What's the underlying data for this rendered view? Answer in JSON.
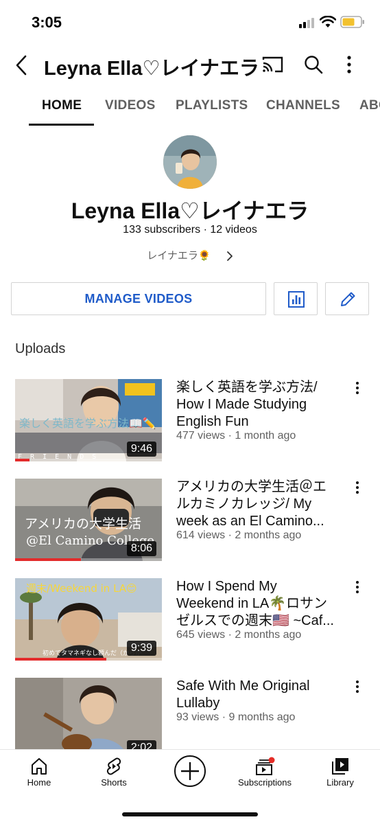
{
  "status_bar": {
    "time": "3:05"
  },
  "header": {
    "title": "Leyna Ella♡レイナエラ"
  },
  "tabs": [
    {
      "label": "HOME",
      "active": true
    },
    {
      "label": "VIDEOS",
      "active": false
    },
    {
      "label": "PLAYLISTS",
      "active": false
    },
    {
      "label": "CHANNELS",
      "active": false
    },
    {
      "label": "ABOUT",
      "active": false
    }
  ],
  "channel": {
    "name": "Leyna Ella♡レイナエラ",
    "meta": "133 subscribers · 12 videos",
    "description": "レイナエラ🌻"
  },
  "actions": {
    "manage_label": "MANAGE VIDEOS"
  },
  "uploads": {
    "label": "Uploads",
    "videos": [
      {
        "title_lines": [
          "楽しく英語を学ぶ方法/",
          "How I Made Studying",
          "English Fun"
        ],
        "meta": "477 views · 1 month ago",
        "duration": "9:46",
        "watched": 0.1,
        "thumb_text": "楽しく英語を学ぶ方法📖✏️"
      },
      {
        "title_lines": [
          "アメリカの大学生活＠エ",
          "ルカミノカレッジ/ My",
          "week as an El Camino..."
        ],
        "meta": "614 views · 2 months ago",
        "duration": "8:06",
        "watched": 0.45,
        "thumb_text": "アメリカの大学生活"
      },
      {
        "title_lines": [
          "How I Spend My",
          "Weekend in LA🌴ロサン",
          "ゼルスでの週末🇺🇸 ~Caf..."
        ],
        "meta": "645 views · 2 months ago",
        "duration": "9:39",
        "watched": 0.62,
        "thumb_text": "週末/Weekend in LA😊"
      },
      {
        "title_lines": [
          "Safe With Me Original",
          "Lullaby"
        ],
        "meta": "93 views · 9 months ago",
        "duration": "2:02",
        "watched": 0.0,
        "thumb_text": ""
      }
    ]
  },
  "bottom_nav": {
    "home": "Home",
    "shorts": "Shorts",
    "subscriptions": "Subscriptions",
    "library": "Library"
  },
  "colors": {
    "accent_blue": "#1f5bc9",
    "progress_red": "#e32b2b",
    "notification_red": "#e52d27"
  }
}
